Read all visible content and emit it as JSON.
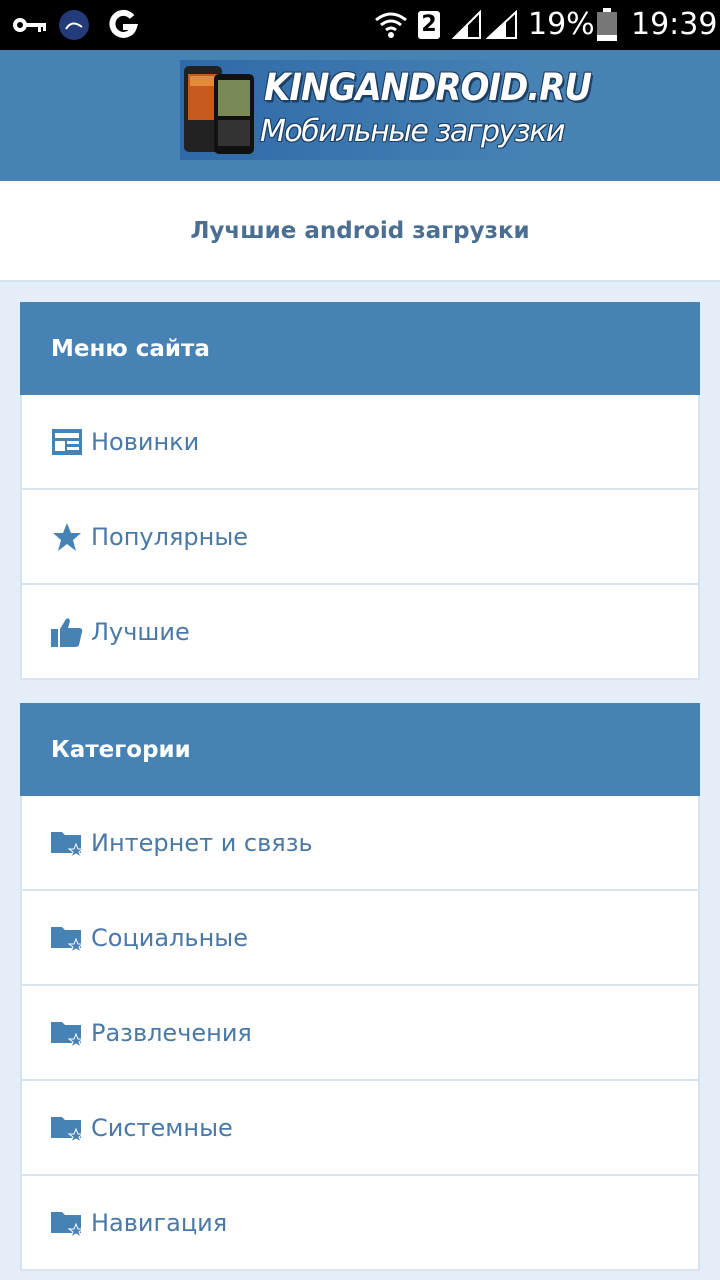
{
  "status_bar": {
    "icons": [
      "key-icon",
      "app-icon",
      "g-icon",
      "wifi-icon",
      "sim-2-icon",
      "signal-icon",
      "signal-icon",
      "battery-icon"
    ],
    "sim_badge": "2",
    "battery": "19%",
    "time": "19:39"
  },
  "header": {
    "logo_title": "KINGANDROID.RU",
    "logo_subtitle": "Мобильные загрузки",
    "background": "#4682b4"
  },
  "subtitle": "Лучшие android загрузки",
  "site_menu": {
    "title": "Меню сайта",
    "items": [
      {
        "label": "Новинки",
        "icon": "news-icon"
      },
      {
        "label": "Популярные",
        "icon": "star-icon"
      },
      {
        "label": "Лучшие",
        "icon": "thumbs-up-icon"
      }
    ]
  },
  "categories": {
    "title": "Категории",
    "items": [
      {
        "label": "Интернет и связь",
        "icon": "folder-star-icon"
      },
      {
        "label": "Социальные",
        "icon": "folder-star-icon"
      },
      {
        "label": "Развлечения",
        "icon": "folder-star-icon"
      },
      {
        "label": "Системные",
        "icon": "folder-star-icon"
      },
      {
        "label": "Навигация",
        "icon": "folder-star-icon"
      }
    ]
  },
  "colors": {
    "accent": "#4682b4",
    "link": "#4a79a8",
    "page_bg": "#e4eef8"
  }
}
